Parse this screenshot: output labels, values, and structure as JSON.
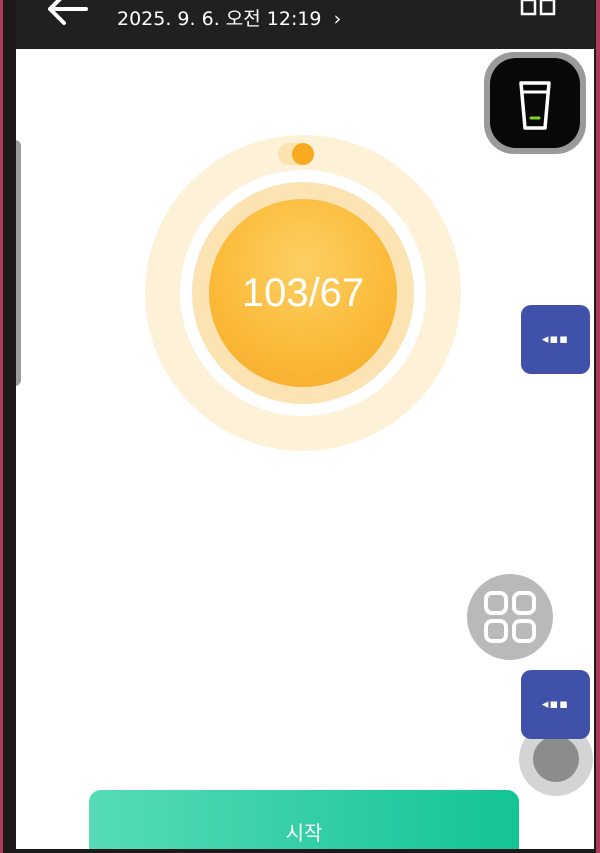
{
  "header": {
    "datetime_label": "2025. 9. 6. 오전 12:19",
    "back_icon": "arrow-left-icon",
    "layout_icon": "grid-icon"
  },
  "cup_widget": {
    "icon": "cup-icon",
    "level_indicator_color": "#7ed321"
  },
  "progress": {
    "value_text": "103/67"
  },
  "floating_buttons": {
    "more_icon": "dots-icon",
    "more_label": "◂▪▪",
    "apps_icon": "four-squares-icon",
    "assist_icon": "assistive-touch-icon"
  },
  "actions": {
    "start_label": "시작"
  },
  "colors": {
    "accent_orange": "#f7aa1f",
    "start_green": "#14c396",
    "floating_blue": "#3f51a8"
  }
}
